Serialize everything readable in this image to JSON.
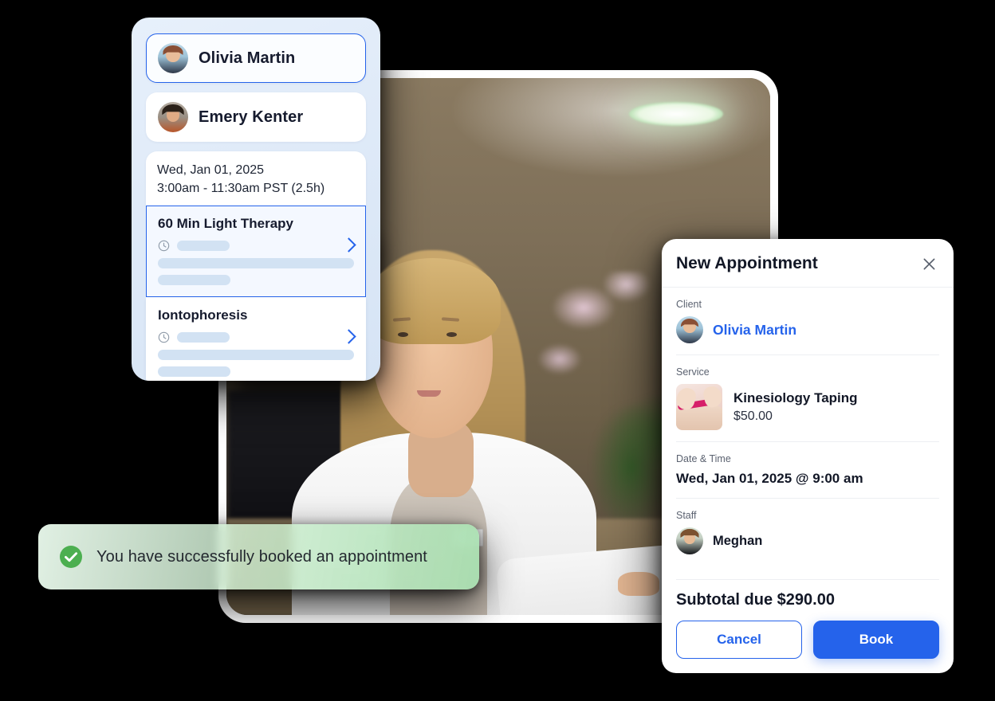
{
  "left_panel": {
    "clients": [
      {
        "name": "Olivia Martin",
        "avatar": "olivia-avatar",
        "selected": true
      },
      {
        "name": "Emery Kenter",
        "avatar": "emery-avatar",
        "selected": false
      }
    ],
    "datetime": {
      "date": "Wed, Jan 01, 2025",
      "time_range": "3:00am - 11:30am PST (2.5h)"
    },
    "services": [
      {
        "title": "60 Min Light Therapy",
        "selected": true,
        "chevron": "chevron-right-icon",
        "duration_icon": "clock-icon"
      },
      {
        "title": "Iontophoresis",
        "selected": false,
        "chevron": "chevron-right-icon",
        "duration_icon": "clock-icon"
      }
    ]
  },
  "dialog": {
    "title": "New Appointment",
    "close_icon": "close-icon",
    "client": {
      "label": "Client",
      "name": "Olivia Martin",
      "avatar": "olivia-avatar"
    },
    "service": {
      "label": "Service",
      "name": "Kinesiology Taping",
      "price": "$50.00",
      "thumbnail": "kinesiology-taping-photo"
    },
    "date_time": {
      "label": "Date & Time",
      "value": "Wed, Jan 01, 2025 @ 9:00 am"
    },
    "staff": {
      "label": "Staff",
      "name": "Meghan",
      "avatar": "meghan-avatar"
    },
    "subtotal": "Subtotal due $290.00",
    "buttons": {
      "cancel": "Cancel",
      "book": "Book"
    }
  },
  "toast": {
    "icon": "success-check-icon",
    "message": "You have successfully booked an appointment"
  },
  "photo": {
    "alt": "receptionist-at-clinic-front-desk",
    "staff_badge": "clinic"
  },
  "colors": {
    "accent_blue": "#2563eb",
    "panel_gradient_start": "#e7f0fb",
    "panel_gradient_end": "#d6e4f5",
    "toast_green": "#4caf50",
    "text_dark": "#121726",
    "skeleton_blue": "#d2e2f3"
  }
}
